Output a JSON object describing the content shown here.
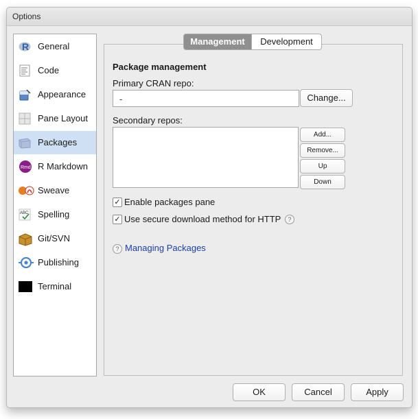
{
  "window": {
    "title": "Options"
  },
  "sidebar": {
    "items": [
      {
        "label": "General"
      },
      {
        "label": "Code"
      },
      {
        "label": "Appearance"
      },
      {
        "label": "Pane Layout"
      },
      {
        "label": "Packages",
        "selected": true
      },
      {
        "label": "R Markdown"
      },
      {
        "label": "Sweave"
      },
      {
        "label": "Spelling"
      },
      {
        "label": "Git/SVN"
      },
      {
        "label": "Publishing"
      },
      {
        "label": "Terminal"
      }
    ],
    "icon_glyphs": {
      "rmd": "Rmd",
      "spelling": "ABC"
    }
  },
  "tabs": {
    "management": "Management",
    "development": "Development",
    "active": "Management"
  },
  "packages": {
    "section_title": "Package management",
    "primary_label": "Primary CRAN repo:",
    "primary_value": "-",
    "change_button": "Change...",
    "secondary_label": "Secondary repos:",
    "add_button": "Add...",
    "remove_button": "Remove...",
    "up_button": "Up",
    "down_button": "Down",
    "enable_pane_label": "Enable packages pane",
    "enable_pane_checked": true,
    "secure_download_label": "Use secure download method for HTTP",
    "secure_download_checked": true,
    "help_glyph": "?",
    "check_glyph": "✓",
    "managing_link": "Managing Packages"
  },
  "footer": {
    "ok": "OK",
    "cancel": "Cancel",
    "apply": "Apply"
  },
  "colors": {
    "selected_row": "#cfe0f4",
    "active_tab": "#8f8f8f",
    "link": "#1c3ea8"
  }
}
